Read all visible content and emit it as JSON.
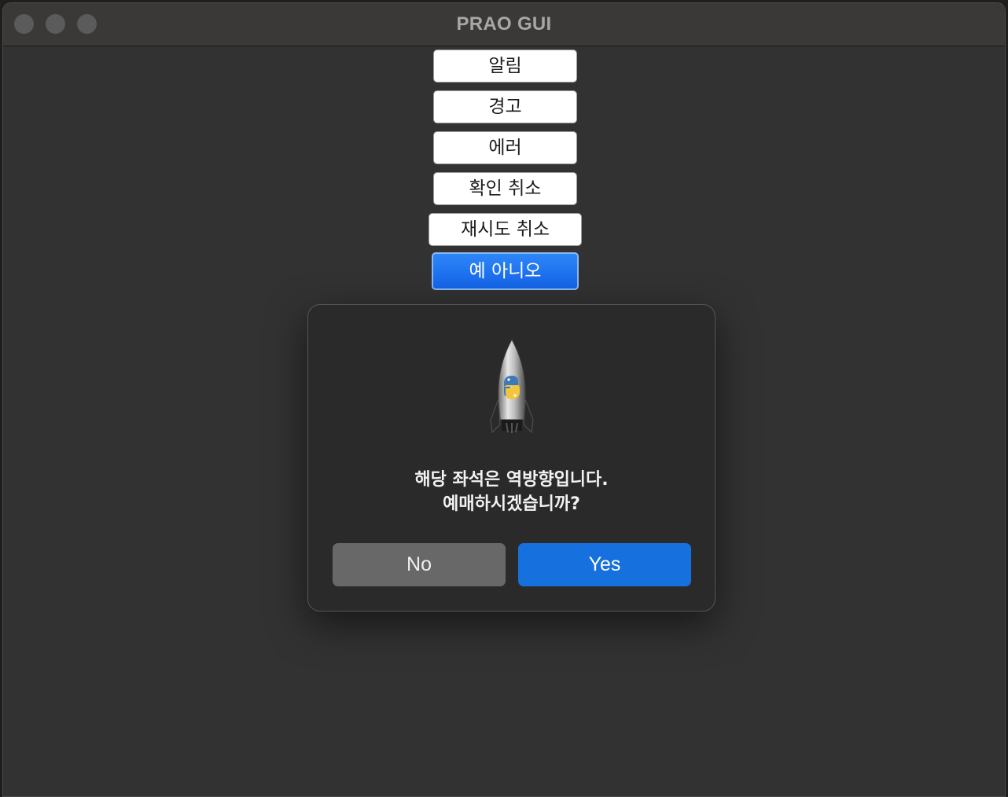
{
  "window": {
    "title": "PRAO GUI"
  },
  "buttons": [
    {
      "label": "알림",
      "active": false
    },
    {
      "label": "경고",
      "active": false
    },
    {
      "label": "에러",
      "active": false
    },
    {
      "label": "확인 취소",
      "active": false
    },
    {
      "label": "재시도 취소",
      "active": false
    },
    {
      "label": "예 아니오",
      "active": true
    }
  ],
  "dialog": {
    "icon": "python-launcher-rocket-icon",
    "message_line1": "해당 좌석은 역방향입니다.",
    "message_line2": "예매하시겠습니까?",
    "no_label": "No",
    "yes_label": "Yes"
  },
  "colors": {
    "accent": "#1670de",
    "window_bg": "#323232",
    "dialog_bg": "#2a2a2a"
  }
}
